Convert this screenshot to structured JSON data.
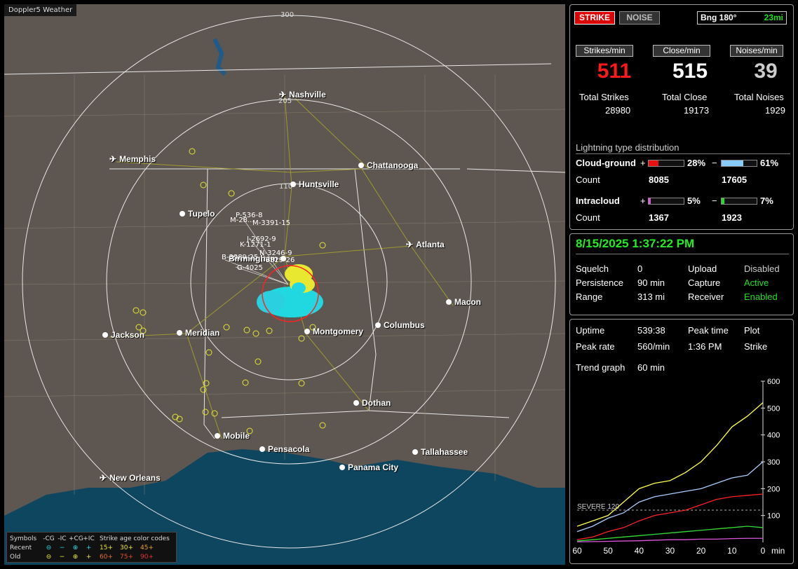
{
  "app_title": "Doppler5 Weather",
  "map": {
    "range_labels": [
      "300",
      "205",
      "110"
    ],
    "cities": [
      {
        "name": "Nashville",
        "kind": "airport"
      },
      {
        "name": "Memphis",
        "kind": "airport"
      },
      {
        "name": "Chattanooga",
        "kind": "city"
      },
      {
        "name": "Huntsville",
        "kind": "city"
      },
      {
        "name": "Tupelo",
        "kind": "city"
      },
      {
        "name": "Atlanta",
        "kind": "airport"
      },
      {
        "name": "Birmingham",
        "kind": "city"
      },
      {
        "name": "Macon",
        "kind": "city"
      },
      {
        "name": "Jackson",
        "kind": "city"
      },
      {
        "name": "Meridian",
        "kind": "city"
      },
      {
        "name": "Montgomery",
        "kind": "city"
      },
      {
        "name": "Columbus",
        "kind": "city"
      },
      {
        "name": "Dothan",
        "kind": "city"
      },
      {
        "name": "Mobile",
        "kind": "city"
      },
      {
        "name": "Pensacola",
        "kind": "city"
      },
      {
        "name": "Tallahassee",
        "kind": "city"
      },
      {
        "name": "Panama City",
        "kind": "city"
      },
      {
        "name": "New Orleans",
        "kind": "airport"
      }
    ],
    "storm_tags": [
      "P-536-8",
      "M-28...",
      "M-3391-15",
      "J-2692-9",
      "K-1271-1",
      "N-3246-9",
      "B-3989-25",
      "I-3329-26",
      "G-4025"
    ]
  },
  "legend": {
    "symbols_label": "Symbols",
    "col_headers": [
      "-CG",
      "-IC",
      "+CG",
      "+IC"
    ],
    "age_header": "Strike age color codes",
    "recent_label": "Recent",
    "old_label": "Old",
    "recent_symbols": [
      "⊖",
      "−",
      "⊕",
      "+"
    ],
    "old_symbols": [
      "⊖",
      "−",
      "⊕",
      "+"
    ],
    "recent_ages": [
      "15+",
      "30+",
      "45+"
    ],
    "old_ages": [
      "60+",
      "75+",
      "90+"
    ]
  },
  "top": {
    "strike_button": "STRIKE",
    "noise_button": "NOISE",
    "bearing": "Bng 180°",
    "distance": "23mi",
    "headers": [
      "Strikes/min",
      "Close/min",
      "Noises/min"
    ],
    "rates": [
      "511",
      "515",
      "39"
    ],
    "total_labels": [
      "Total Strikes",
      "Total Close",
      "Total Noises"
    ],
    "totals": [
      "28980",
      "19173",
      "1929"
    ],
    "dist_title": "Lightning type distribution",
    "cloud_ground_label": "Cloud-ground",
    "intracloud_label": "Intracloud",
    "count_label": "Count",
    "cg_pos_sign": "+",
    "cg_neg_sign": "−",
    "cg_pos_pct": "28%",
    "cg_neg_pct": "61%",
    "cg_pos_frac": 0.28,
    "cg_neg_frac": 0.61,
    "cg_pos_count": "8085",
    "cg_neg_count": "17605",
    "ic_pos_sign": "+",
    "ic_neg_sign": "−",
    "ic_pos_pct": "5%",
    "ic_neg_pct": "7%",
    "ic_pos_frac": 0.05,
    "ic_neg_frac": 0.07,
    "ic_pos_count": "1367",
    "ic_neg_count": "1923"
  },
  "status": {
    "datetime": "8/15/2025 1:37:22 PM",
    "squelch_label": "Squelch",
    "squelch": "0",
    "persistence_label": "Persistence",
    "persistence": "90 min",
    "range_label": "Range",
    "range": "313 mi",
    "upload_label": "Upload",
    "upload": "Disabled",
    "capture_label": "Capture",
    "capture": "Active",
    "receiver_label": "Receiver",
    "receiver": "Enabled"
  },
  "trend": {
    "uptime_label": "Uptime",
    "uptime": "539:38",
    "peak_time_label": "Peak time",
    "peak_time": "1:36 PM",
    "plot_label": "Plot",
    "plot": "Strike",
    "peak_rate_label": "Peak rate",
    "peak_rate": "560/min",
    "trend_graph_label": "Trend graph",
    "trend_graph": "60 min",
    "severe_label": "SEVERE 120",
    "x_unit": "min"
  },
  "chart_data": {
    "type": "line",
    "x_ticks": [
      "60",
      "50",
      "40",
      "30",
      "20",
      "10",
      "0"
    ],
    "y_ticks": [
      "600",
      "500",
      "400",
      "300",
      "200",
      "100"
    ],
    "ylim": [
      0,
      600
    ],
    "xlim": [
      60,
      0
    ],
    "threshold": 120,
    "x": [
      60,
      55,
      50,
      45,
      40,
      35,
      30,
      25,
      20,
      15,
      10,
      5,
      0
    ],
    "series": [
      {
        "color": "#ffff55",
        "values": [
          60,
          80,
          100,
          150,
          200,
          220,
          230,
          260,
          300,
          360,
          430,
          470,
          520
        ]
      },
      {
        "color": "#aaccff",
        "values": [
          40,
          60,
          90,
          110,
          150,
          170,
          180,
          190,
          200,
          220,
          240,
          250,
          300
        ]
      },
      {
        "color": "#ff2222",
        "values": [
          10,
          20,
          40,
          55,
          80,
          100,
          110,
          120,
          140,
          160,
          170,
          175,
          180
        ]
      },
      {
        "color": "#33dd33",
        "values": [
          5,
          10,
          15,
          20,
          25,
          30,
          35,
          40,
          45,
          50,
          55,
          60,
          55
        ]
      },
      {
        "color": "#dd55dd",
        "values": [
          2,
          3,
          4,
          5,
          6,
          8,
          10,
          10,
          12,
          12,
          14,
          15,
          15
        ]
      }
    ]
  }
}
